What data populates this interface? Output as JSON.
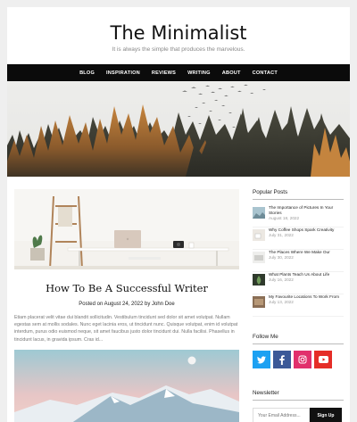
{
  "site": {
    "title": "The Minimalist",
    "tagline": "It is always the simple that produces the marvelous."
  },
  "nav": {
    "items": [
      "BLOG",
      "INSPIRATION",
      "REVIEWS",
      "WRITING",
      "ABOUT",
      "CONTACT"
    ]
  },
  "post": {
    "title": "How To Be A Successful Writer",
    "meta": "Posted on August 24, 2022 by John Doe",
    "excerpt": "Etiam placerat velit vitae dui blandit sollicitudin. Vestibulum tincidunt sed dolor sit amet volutpat. Nullam egestas sem at mollis sodales. Nunc eget lacinia eros, ut tincidunt nunc. Quisque volutpat, enim id volutpat interdum, purus odio euismod neque, sit amet faucibus justo dolor tincidunt dui. Nulla facilisi. Phasellus in tincidunt lacus, in gravida ipsum. Cras id..."
  },
  "sidebar": {
    "popular_title": "Popular Posts",
    "popular": [
      {
        "title": "The Importance of Pictures In Your Stories",
        "date": "August 18, 2022"
      },
      {
        "title": "Why Coffee Shops Spark Creativity",
        "date": "July 31, 2022"
      },
      {
        "title": "The Places Where We Make Our",
        "date": "July 30, 2022"
      },
      {
        "title": "What Plants Teach Us About Life",
        "date": "July 16, 2022"
      },
      {
        "title": "My Favourite Locations To Work From",
        "date": "July 13, 2022"
      }
    ],
    "follow_title": "Follow Me",
    "social": [
      {
        "name": "twitter",
        "color": "#1da1f2"
      },
      {
        "name": "facebook",
        "color": "#3b5998"
      },
      {
        "name": "instagram",
        "color": "#e1306c"
      },
      {
        "name": "youtube",
        "color": "#e52d27"
      }
    ],
    "newsletter_title": "Newsletter",
    "newsletter_placeholder": "Your Email Address...",
    "newsletter_button": "Sign Up"
  }
}
